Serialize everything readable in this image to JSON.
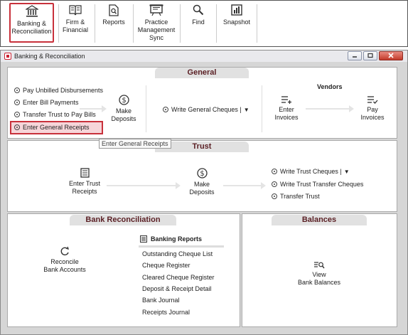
{
  "ribbon": {
    "items": [
      {
        "label": "Banking &\nReconciliation",
        "icon": "bank-icon"
      },
      {
        "label": "Firm &\nFinancial",
        "icon": "book-icon"
      },
      {
        "label": "Reports",
        "icon": "report-icon"
      },
      {
        "label": "Practice\nManagement\nSync",
        "icon": "sync-board-icon"
      },
      {
        "label": "Find",
        "icon": "search-icon"
      },
      {
        "label": "Snapshot",
        "icon": "snapshot-icon"
      }
    ],
    "selected": "Banking & Reconciliation",
    "accent": "#c8313b"
  },
  "window": {
    "title": "Banking & Reconciliation",
    "controls": [
      "minimize",
      "restore",
      "close"
    ]
  },
  "general": {
    "title": "General",
    "left_items": [
      "Pay Unbilled Disbursements",
      "Enter Bill Payments",
      "Transfer Trust to Pay Bills",
      "Enter General Receipts"
    ],
    "make_deposits": "Make\nDeposits",
    "write_cheques": "Write General Cheques |",
    "vendors_title": "Vendors",
    "enter_invoices": "Enter\nInvoices",
    "pay_invoices": "Pay\nInvoices",
    "tooltip": "Enter General Receipts"
  },
  "trust": {
    "title": "Trust",
    "enter_receipts": "Enter Trust\nReceipts",
    "make_deposits": "Make\nDeposits",
    "right_items": [
      "Write Trust Cheques |",
      "Write Trust Transfer Cheques",
      "Transfer Trust"
    ]
  },
  "bank_rec": {
    "title": "Bank Reconciliation",
    "reconcile": "Reconcile\nBank Accounts",
    "reports_title": "Banking Reports",
    "reports": [
      "Outstanding Cheque List",
      "Cheque Register",
      "Cleared Cheque Register",
      "Deposit & Receipt Detail",
      "Bank Journal",
      "Receipts Journal"
    ]
  },
  "balances": {
    "title": "Balances",
    "view": "View\nBank Balances"
  }
}
